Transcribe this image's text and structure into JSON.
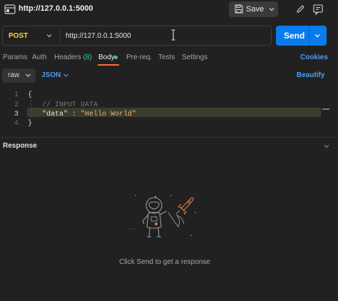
{
  "title_bar": {
    "title": "http://127.0.0.1:5000",
    "save_label": "Save"
  },
  "request": {
    "method": "POST",
    "url": "http://127.0.0.1:5000",
    "send_label": "Send"
  },
  "tabs": [
    {
      "label": "Params"
    },
    {
      "label": "Auth"
    },
    {
      "label": "Headers",
      "count": "(8)"
    },
    {
      "label": "Body",
      "active": true
    },
    {
      "label": "Pre-req."
    },
    {
      "label": "Tests"
    },
    {
      "label": "Settings"
    }
  ],
  "cookies_label": "Cookies",
  "body_options": {
    "type": "raw",
    "language": "JSON",
    "beautify_label": "Beautify"
  },
  "editor": {
    "line_numbers": [
      "1",
      "2",
      "3",
      "4"
    ],
    "line1": "{",
    "line2_comment": "// INPUT DATA",
    "line3_key": "\"data\"",
    "line3_sep": " : ",
    "line3_value": "\"Hello World\"",
    "line4": "}"
  },
  "response": {
    "label": "Response",
    "empty_message": "Click Send to get a response"
  },
  "colors": {
    "accent_send": "#097bed",
    "method_post": "#ffd23f",
    "active_tab_underline": "#ff6c37",
    "link_blue": "#4a9ff5",
    "body_dot": "#45c38a"
  },
  "icons": [
    "globe-icon",
    "save-icon",
    "chevron-down-icon",
    "pencil-icon",
    "comment-icon",
    "text-cursor-icon",
    "astronaut-illustration"
  ]
}
